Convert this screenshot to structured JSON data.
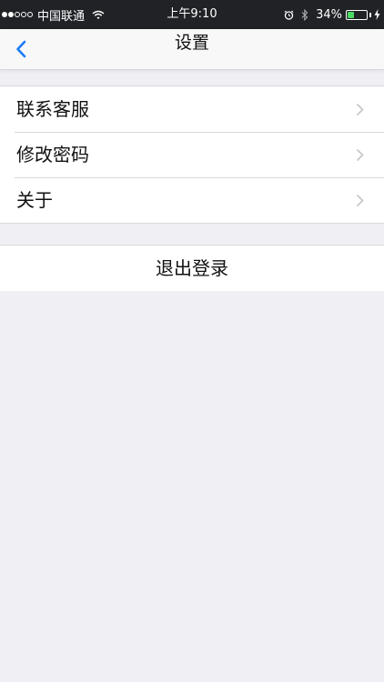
{
  "status_bar": {
    "carrier": "中国联通",
    "time": "上午9:10",
    "battery_percent": "34%",
    "battery_level": 0.34,
    "signal_strength": 2,
    "signal_max": 5,
    "icons": [
      "signal-dots",
      "wifi-icon",
      "alarm-icon",
      "bluetooth-icon",
      "battery-icon",
      "charging-icon"
    ]
  },
  "nav": {
    "title": "设置",
    "back_icon": "chevron-left-icon",
    "accent_color": "#1b7cf6"
  },
  "settings": {
    "items": [
      {
        "label": "联系客服",
        "icon": "chevron-right-icon"
      },
      {
        "label": "修改密码",
        "icon": "chevron-right-icon"
      },
      {
        "label": "关于",
        "icon": "chevron-right-icon"
      }
    ]
  },
  "logout": {
    "label": "退出登录"
  },
  "colors": {
    "background": "#efeff4",
    "status_bar": "#212226",
    "battery_fill": "#4cd964"
  }
}
